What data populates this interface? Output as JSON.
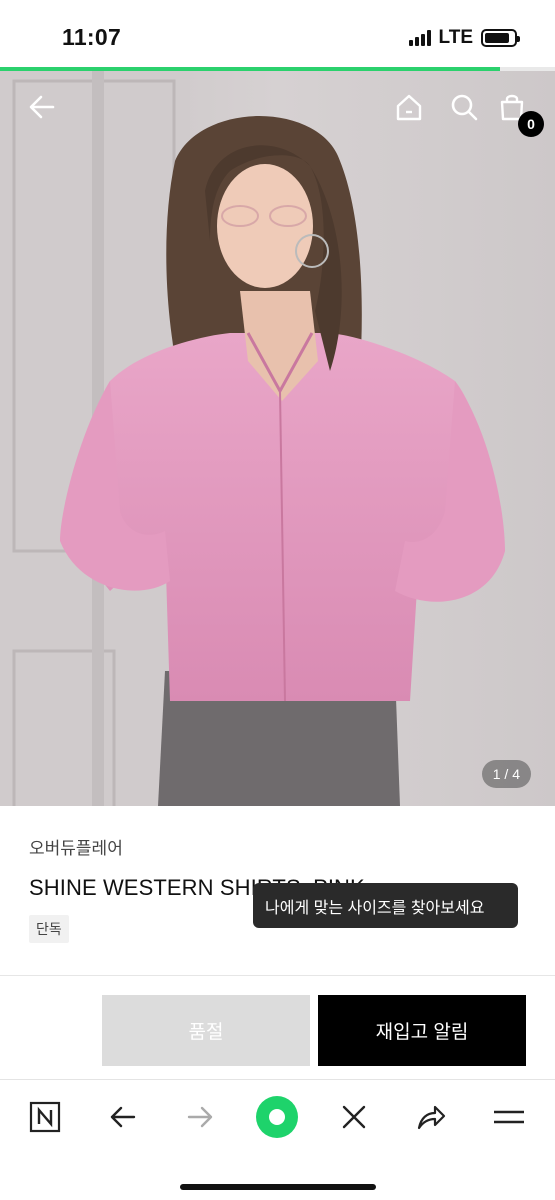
{
  "status_bar": {
    "time": "11:07",
    "network": "LTE",
    "battery_level": 0.85,
    "signal_bars": 4
  },
  "page_load_progress": 0.9,
  "hero": {
    "cart_count": "0",
    "pager": "1 / 4",
    "icons": [
      "back-arrow-icon",
      "home-icon",
      "search-icon",
      "shopping-bag-icon"
    ]
  },
  "product": {
    "brand": "오버듀플레어",
    "title": "SHINE WESTERN SHIRTS_PINK",
    "tag": "단독"
  },
  "tooltip": "나에게 맞는 사이즈를 찾아보세요",
  "actions": {
    "soldout_label": "품절",
    "restock_label": "재입고 알림"
  },
  "browser_bar": {
    "icons": [
      "naver-icon",
      "back-icon",
      "forward-icon",
      "green-dot-icon",
      "close-icon",
      "share-icon",
      "menu-icon"
    ]
  },
  "colors": {
    "accent": "#2bd16d",
    "shirt": "#e59ac0",
    "button_dark": "#000000",
    "button_disabled": "#dcdcdc"
  }
}
